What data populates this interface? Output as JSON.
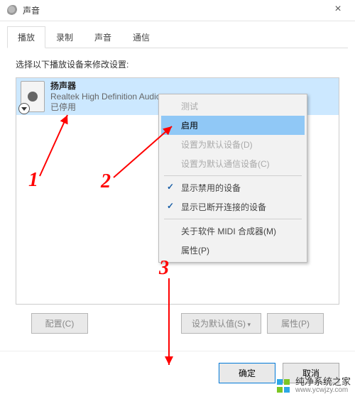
{
  "window": {
    "title": "声音",
    "close": "×"
  },
  "tabs": [
    {
      "label": "播放",
      "active": true
    },
    {
      "label": "录制",
      "active": false
    },
    {
      "label": "声音",
      "active": false
    },
    {
      "label": "通信",
      "active": false
    }
  ],
  "instruction": "选择以下播放设备来修改设置:",
  "device": {
    "name": "扬声器",
    "driver": "Realtek High Definition Audio",
    "status": "已停用"
  },
  "context_menu": [
    {
      "label": "测试",
      "type": "disabled"
    },
    {
      "label": "启用",
      "type": "selected"
    },
    {
      "label": "设置为默认设备(D)",
      "type": "disabled"
    },
    {
      "label": "设置为默认通信设备(C)",
      "type": "disabled"
    },
    {
      "sep": true
    },
    {
      "label": "显示禁用的设备",
      "type": "checked"
    },
    {
      "label": "显示已断开连接的设备",
      "type": "checked"
    },
    {
      "sep": true
    },
    {
      "label": "关于软件 MIDI 合成器(M)",
      "type": "normal"
    },
    {
      "label": "属性(P)",
      "type": "normal"
    }
  ],
  "bottom_buttons": {
    "configure": "配置(C)",
    "set_default": "设为默认值(S)",
    "properties": "属性(P)"
  },
  "dialog_buttons": {
    "ok": "确定",
    "cancel": "取消"
  },
  "annotations": {
    "n1": "1",
    "n2": "2",
    "n3": "3"
  },
  "watermark": {
    "name": "纯净系统之家",
    "url": "www.ycwjzy.com"
  }
}
